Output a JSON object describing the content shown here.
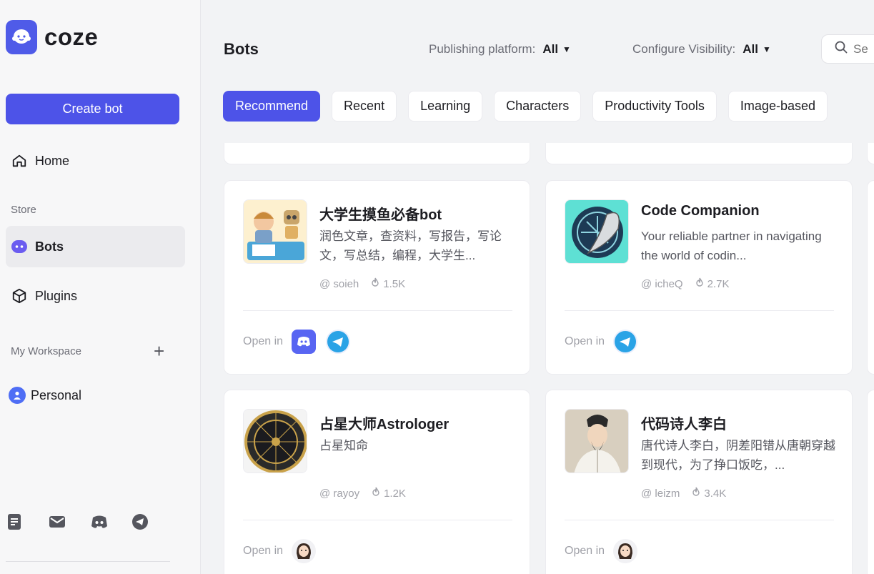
{
  "brand": {
    "name": "coze"
  },
  "sidebar": {
    "create_button": "Create bot",
    "home": "Home",
    "store_label": "Store",
    "bots": "Bots",
    "plugins": "Plugins",
    "workspace_label": "My Workspace",
    "workspace_add": "+",
    "personal": "Personal"
  },
  "header": {
    "title": "Bots",
    "platform_label": "Publishing platform:",
    "platform_value": "All",
    "visibility_label": "Configure Visibility:",
    "visibility_value": "All",
    "search_placeholder": "Se"
  },
  "tabs": [
    "Recommend",
    "Recent",
    "Learning",
    "Characters",
    "Productivity Tools",
    "Image-based"
  ],
  "cards": [
    {
      "name": "大学生摸鱼必备bot",
      "description": "润色文章，查资料，写报告，写论文，写总结，编程，大学生...",
      "author": "@ soieh",
      "count": "1.5K",
      "open_label": "Open in",
      "platforms": [
        "discord",
        "telegram"
      ]
    },
    {
      "name": "Code Companion",
      "description": "Your reliable partner in navigating the world of codin...",
      "author": "@ icheQ",
      "count": "2.7K",
      "open_label": "Open in",
      "platforms": [
        "telegram"
      ]
    },
    {
      "name": "占星大师Astrologer",
      "description": "占星知命",
      "author": "@ rayoy",
      "count": "1.2K",
      "open_label": "Open in",
      "platforms": [
        "user"
      ]
    },
    {
      "name": "代码诗人李白",
      "description": "唐代诗人李白，阴差阳错从唐朝穿越到现代，为了挣口饭吃，...",
      "author": "@ leizm",
      "count": "3.4K",
      "open_label": "Open in",
      "platforms": [
        "user"
      ]
    }
  ],
  "colors": {
    "accent": "#4d53e8",
    "discord": "#5865f2",
    "telegram": "#2aa3e6"
  }
}
